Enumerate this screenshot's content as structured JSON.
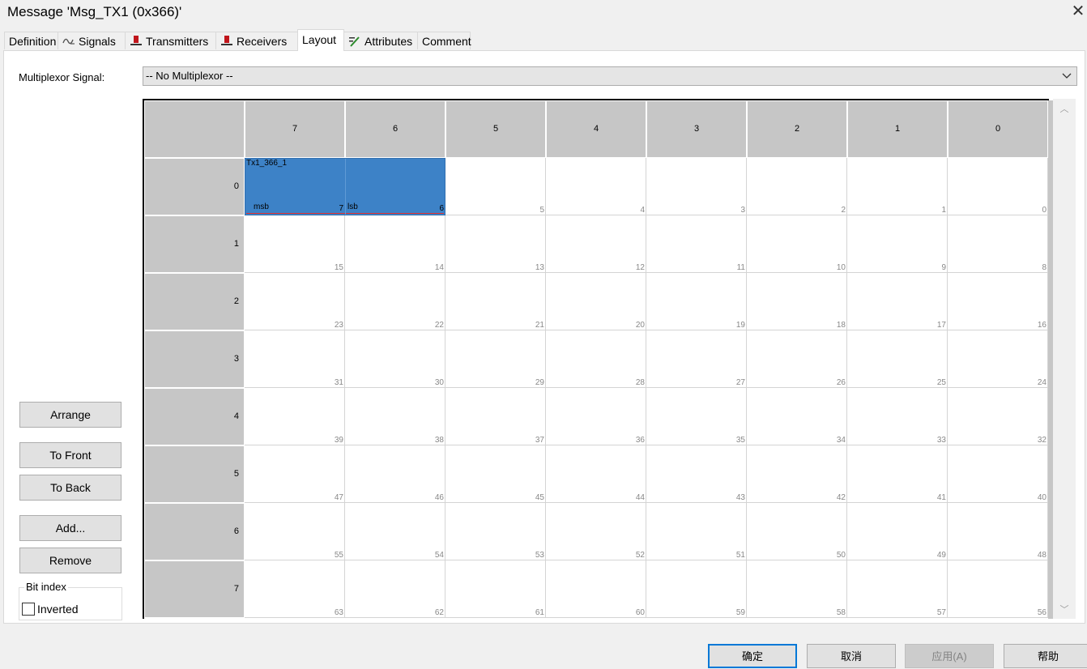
{
  "window": {
    "title": "Message 'Msg_TX1 (0x366)'"
  },
  "tabs": [
    {
      "label": "Definition",
      "icon": ""
    },
    {
      "label": "Signals",
      "icon": "signal-wave-icon"
    },
    {
      "label": "Transmitters",
      "icon": "node-icon"
    },
    {
      "label": "Receivers",
      "icon": "node-icon"
    },
    {
      "label": "Layout",
      "icon": "",
      "active": true
    },
    {
      "label": "Attributes",
      "icon": "edit-pencil-icon"
    },
    {
      "label": "Comment",
      "icon": ""
    }
  ],
  "multiplexor": {
    "label": "Multiplexor Signal:",
    "value": "-- No Multiplexor --"
  },
  "grid": {
    "column_headers": [
      "7",
      "6",
      "5",
      "4",
      "3",
      "2",
      "1",
      "0"
    ],
    "row_headers": [
      "0",
      "1",
      "2",
      "3",
      "4",
      "5",
      "6",
      "7"
    ],
    "signal": {
      "name": "Tx1_366_1",
      "msb_label": "msb",
      "lsb_label": "lsb",
      "msb_bit": "7",
      "lsb_bit": "6"
    }
  },
  "buttons": {
    "arrange": "Arrange",
    "to_front": "To Front",
    "to_back": "To Back",
    "add": "Add...",
    "remove": "Remove"
  },
  "bit_index": {
    "title": "Bit index",
    "inverted_label": "Inverted",
    "inverted_checked": false
  },
  "footer": {
    "ok": "确定",
    "cancel": "取消",
    "apply": "应用(A)",
    "help": "帮助"
  },
  "colors": {
    "signal_fill": "#3d82c7",
    "header_gray": "#c6c6c6",
    "accent": "#0078d7"
  }
}
